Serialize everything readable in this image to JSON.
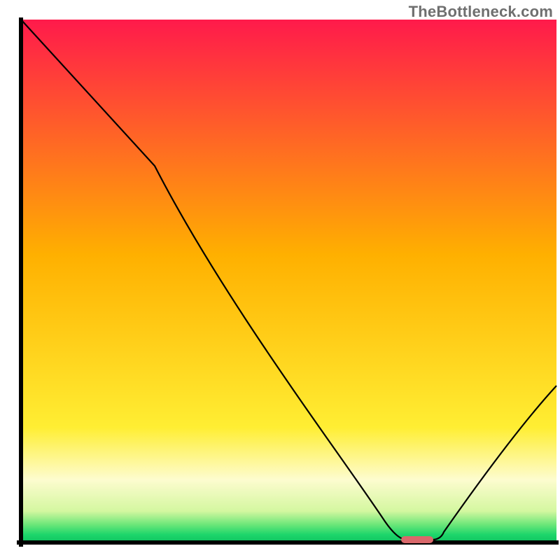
{
  "attribution": {
    "label": "TheBottleneck.com"
  },
  "chart_data": {
    "type": "line",
    "title": "",
    "xlabel": "",
    "ylabel": "",
    "x_range": [
      0,
      100
    ],
    "y_range": [
      0,
      100
    ],
    "grid": false,
    "legend": false,
    "background": {
      "type": "vertical-gradient",
      "stops": [
        {
          "offset": 0.0,
          "color": "#ff1a4b"
        },
        {
          "offset": 0.45,
          "color": "#ffb000"
        },
        {
          "offset": 0.78,
          "color": "#ffee33"
        },
        {
          "offset": 0.88,
          "color": "#fdfccf"
        },
        {
          "offset": 0.94,
          "color": "#d4f7a0"
        },
        {
          "offset": 0.965,
          "color": "#6fe77a"
        },
        {
          "offset": 0.985,
          "color": "#1dd66b"
        },
        {
          "offset": 1.0,
          "color": "#0fc25f"
        }
      ]
    },
    "series": [
      {
        "name": "bottleneck-curve",
        "color": "#000000",
        "x": [
          0,
          25,
          68,
          72,
          77,
          79,
          100
        ],
        "y": [
          100,
          72,
          4,
          0.5,
          0.5,
          2,
          30
        ]
      }
    ],
    "marker": {
      "name": "optimal-range",
      "shape": "pill",
      "color": "#d9686b",
      "x_center": 74,
      "y_center": 0.5,
      "width": 6,
      "height": 1.3
    },
    "axes": {
      "color": "#000000",
      "thickness_px": 6,
      "frame": "left-bottom"
    }
  }
}
